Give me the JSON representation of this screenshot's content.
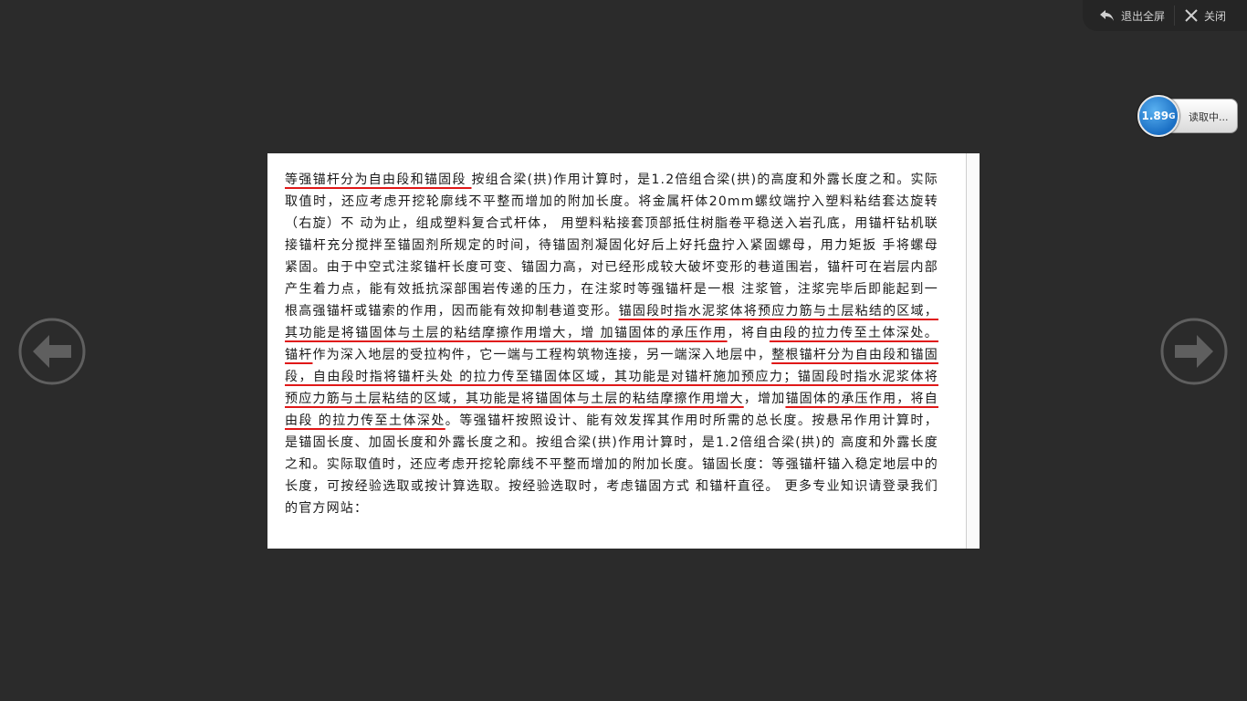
{
  "toolbar": {
    "exit_fullscreen_label": "退出全屏",
    "close_label": "关闭"
  },
  "loading": {
    "size_value": "1.89",
    "size_unit": "G",
    "status": "读取中..."
  },
  "document": {
    "segments": [
      {
        "text": "等强锚杆分为自由段和锚固段 ",
        "highlight": true
      },
      {
        "text": "按组合梁(拱)作用计算时，是1.2倍组合梁(拱)的高度和外露长度之和。实际取值时，还应考虑开挖轮廓线不平整而增加的附加长度。将金属杆体20mm螺纹端拧入塑料粘结套达旋转（右旋）不 动为止，组成塑料复合式杆体， 用塑料粘接套顶部抵住树脂卷平稳送入岩孔底，用锚杆钻机联接锚杆充分搅拌至锚固剂所规定的时间，待锚固剂凝固化好后上好托盘拧入紧固螺母，用力矩扳 手将螺母紧固。由于中空式注浆锚杆长度可变、锚固力高，对已经形成较大破坏变形的巷道围岩，锚杆可在岩层内部产生着力点，能有效抵抗深部围岩传递的压力，在注浆时等强锚杆是一根 注浆管，注浆完毕后即能起到一根高强锚杆或锚索的作用，因而能有效抑制巷道变形。",
        "highlight": false
      },
      {
        "text": "锚固段时指水泥浆体将预应力筋与土层粘结的区域，其功能是将锚固体与土层的粘结摩擦作用增大，增 加锚固体的承压作用",
        "highlight": true
      },
      {
        "text": "，将自",
        "highlight": false
      },
      {
        "text": "由段的拉力传至土体深处。锚杆",
        "highlight": true
      },
      {
        "text": "作为深入地层的受拉构件，它一端与工程构筑物连接，另一端深入地层中，",
        "highlight": false
      },
      {
        "text": "整根锚杆分为自由段和锚固段，自由段时指将锚杆头处 的拉力传至锚固体区域，其功能是对锚杆施加预应力；锚固段时指水泥浆体将预应力筋与土层粘结的区域，其功能是将锚固体与土层的粘结摩擦作用增大",
        "highlight": true
      },
      {
        "text": "，增加",
        "highlight": false
      },
      {
        "text": "锚固体的承压作用，将自由段 的拉力传至土体深处",
        "highlight": true
      },
      {
        "text": "。等强锚杆按照设计、能有效发挥其作用时所需的总长度。按悬吊作用计算时，是锚固长度、加固长度和外露长度之和。按组合梁(拱)作用计算时，是1.2倍组合梁(拱)的 高度和外露长度之和。实际取值时，还应考虑开挖轮廓线不平整而增加的附加长度。锚固长度：等强锚杆锚入稳定地层中的长度，可按经验选取或按计算选取。按经验选取时，考虑锚固方式 和锚杆直径。 更多专业知识请登录我们的官方网站：",
        "highlight": false
      }
    ]
  },
  "colors": {
    "background": "#2b2b2b",
    "highlight_underline": "#e01818",
    "loading_blue": "#1a6fc4"
  },
  "icons": {
    "exit_fullscreen": "exit-fullscreen-icon",
    "close": "close-icon",
    "prev": "arrow-left-icon",
    "next": "arrow-right-icon"
  }
}
